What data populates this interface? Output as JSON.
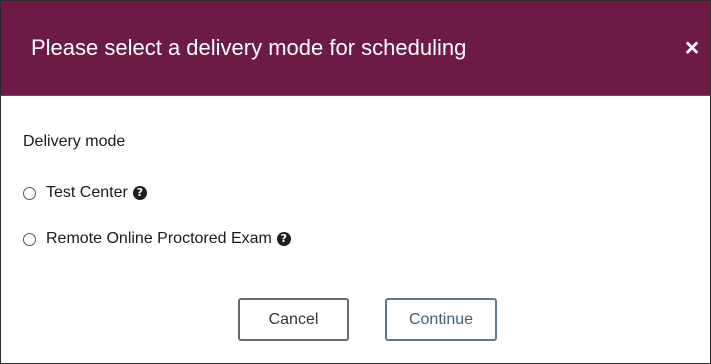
{
  "dialog": {
    "title": "Please select a delivery mode for scheduling",
    "close_icon": "close-icon",
    "close_glyph": "×"
  },
  "form": {
    "section_label": "Delivery mode",
    "options": [
      {
        "label": "Test Center",
        "selected": false,
        "help_icon": "question-circle-icon"
      },
      {
        "label": "Remote Online Proctored Exam",
        "selected": false,
        "help_icon": "question-circle-icon"
      }
    ]
  },
  "actions": {
    "cancel_label": "Cancel",
    "continue_label": "Continue"
  },
  "colors": {
    "header_background": "#6d1a45",
    "continue_accent": "#5f7a8e"
  }
}
